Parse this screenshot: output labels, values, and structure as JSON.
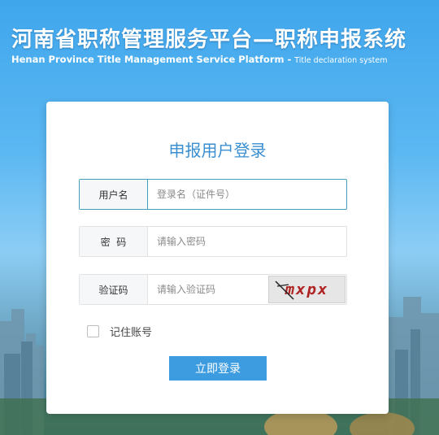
{
  "header": {
    "title_cn": "河南省职称管理服务平台—职称申报系统",
    "title_en": "Henan Province Title Management Service Platform - ",
    "title_en_sub": "Title declaration system"
  },
  "login": {
    "title": "申报用户登录",
    "username_label": "用户名",
    "username_placeholder": "登录名（证件号）",
    "password_label": "密  码",
    "password_placeholder": "请输入密码",
    "captcha_label": "验证码",
    "captcha_placeholder": "请输入验证码",
    "captcha_text": "mxpx",
    "remember_label": "记住账号",
    "submit_label": "立即登录"
  },
  "colors": {
    "accent": "#3d9ce0",
    "title": "#3b8fd0",
    "active_border": "#3fa0b8"
  },
  "icons": [
    "captcha-image"
  ]
}
